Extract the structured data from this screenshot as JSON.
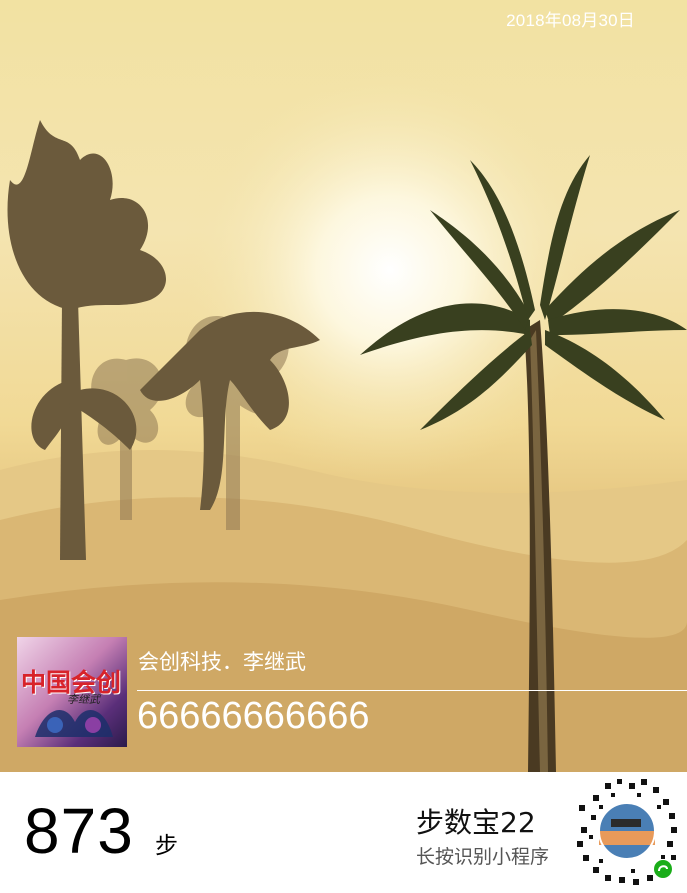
{
  "header": {
    "date": "2018年08月30日"
  },
  "profile": {
    "avatar_title": "中国会创",
    "avatar_signature": "李继武",
    "name": "会创科技．李继武",
    "phone": "66666666666"
  },
  "stats": {
    "steps": "873",
    "unit": "步"
  },
  "miniprogram": {
    "name": "步数宝22",
    "hint": "长按识别小程序",
    "icon": "wechat-miniprogram-icon"
  },
  "colors": {
    "sky_top": "#f2e2a2",
    "sand": "#cfa865",
    "tree_silhouette": "#6b5a3c",
    "palm_leaves": "#39401f",
    "text_white": "#ffffff"
  }
}
